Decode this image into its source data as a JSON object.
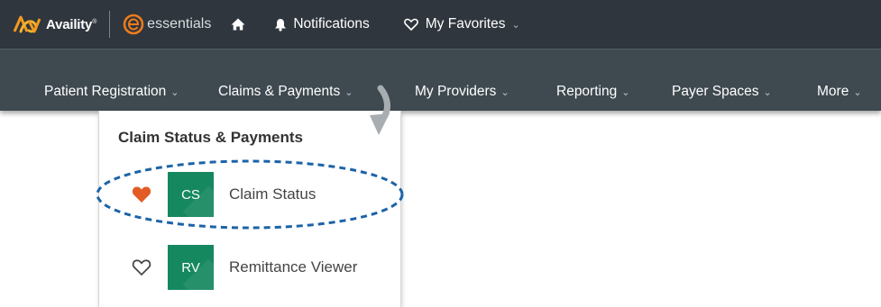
{
  "topbar": {
    "brand": "Availity",
    "brand_mark": "®",
    "essentials": "essentials",
    "home_icon": "home-icon",
    "notifications": "Notifications",
    "favorites": "My Favorites"
  },
  "nav": {
    "items": [
      {
        "label": "Patient Registration"
      },
      {
        "label": "Claims & Payments"
      },
      {
        "label": "My Providers"
      },
      {
        "label": "Reporting"
      },
      {
        "label": "Payer Spaces"
      },
      {
        "label": "More"
      }
    ]
  },
  "dropdown": {
    "heading": "Claim Status & Payments",
    "items": [
      {
        "abbr": "CS",
        "label": "Claim Status",
        "favorited": true
      },
      {
        "abbr": "RV",
        "label": "Remittance Viewer",
        "favorited": false
      }
    ]
  },
  "colors": {
    "topbar": "#2f363d",
    "navbar": "#3f4950",
    "tile": "#168860",
    "heart_filled": "#e35b25",
    "annotation": "#1c63a8"
  }
}
